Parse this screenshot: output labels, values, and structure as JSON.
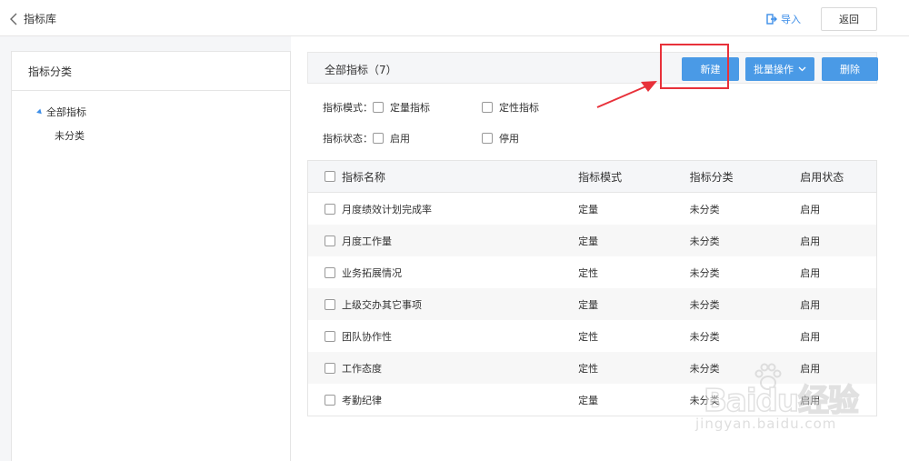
{
  "topbar": {
    "title": "指标库",
    "import_label": "导入",
    "return_label": "返回"
  },
  "sidebar": {
    "title": "指标分类",
    "tree": [
      {
        "label": "全部指标"
      },
      {
        "label": "未分类"
      }
    ]
  },
  "toolbar": {
    "title": "全部指标（7）",
    "new_label": "新建",
    "batch_label": "批量操作",
    "delete_label": "删除"
  },
  "filters": {
    "mode_label": "指标模式：",
    "mode_options": [
      "定量指标",
      "定性指标"
    ],
    "status_label": "指标状态：",
    "status_options": [
      "启用",
      "停用"
    ]
  },
  "table": {
    "headers": [
      "指标名称",
      "指标模式",
      "指标分类",
      "启用状态"
    ],
    "rows": [
      [
        "月度绩效计划完成率",
        "定量",
        "未分类",
        "启用"
      ],
      [
        "月度工作量",
        "定量",
        "未分类",
        "启用"
      ],
      [
        "业务拓展情况",
        "定性",
        "未分类",
        "启用"
      ],
      [
        "上级交办其它事项",
        "定量",
        "未分类",
        "启用"
      ],
      [
        "团队协作性",
        "定性",
        "未分类",
        "启用"
      ],
      [
        "工作态度",
        "定性",
        "未分类",
        "启用"
      ],
      [
        "考勤纪律",
        "定量",
        "未分类",
        "启用"
      ]
    ]
  },
  "watermark": {
    "brand": "Baidu经验",
    "url": "jingyan.baidu.com"
  },
  "colors": {
    "accent": "#4a9ae6",
    "highlight": "#e8313a"
  }
}
